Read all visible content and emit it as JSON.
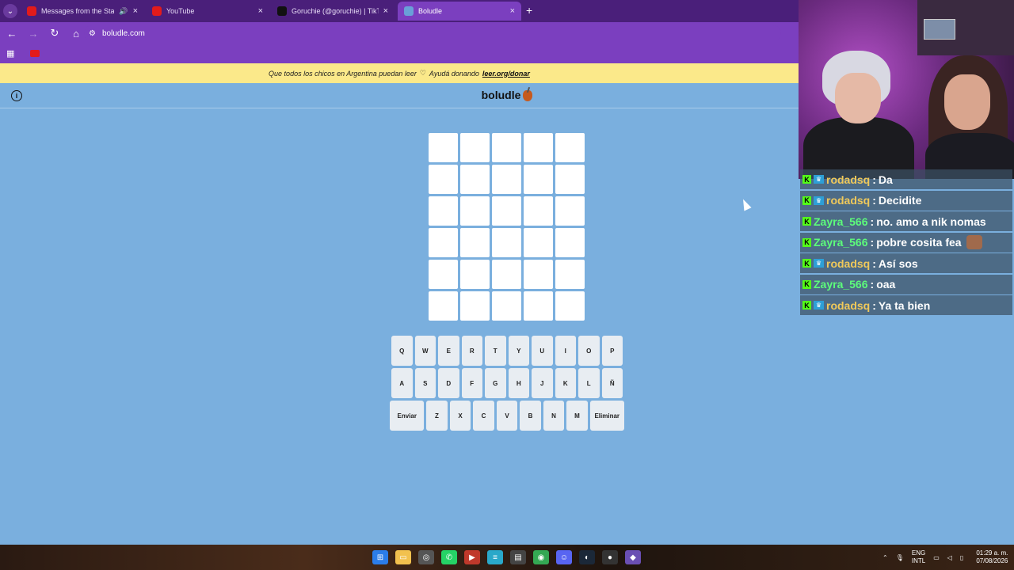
{
  "browser": {
    "tabs": [
      {
        "title": "Messages from the Stars - Y",
        "icon": "youtube-icon",
        "color": "#e21b1b",
        "muted": true
      },
      {
        "title": "YouTube",
        "icon": "youtube-icon",
        "color": "#e21b1b",
        "muted": false
      },
      {
        "title": "Goruchie (@goruchie) | TikTok",
        "icon": "tiktok-icon",
        "color": "#111111",
        "muted": false
      },
      {
        "title": "Boludle",
        "icon": "globe-icon",
        "color": "#6aa0d8",
        "muted": false
      }
    ],
    "url": "boludle.com"
  },
  "banner": {
    "text": "Que todos los chicos en Argentina puedan leer",
    "cta": "Ayudá donando",
    "link": "leer.org/donar"
  },
  "header": {
    "title": "boludle"
  },
  "board": {
    "rows": 6,
    "cols": 5
  },
  "keyboard": {
    "row1": [
      "Q",
      "W",
      "E",
      "R",
      "T",
      "Y",
      "U",
      "I",
      "O",
      "P"
    ],
    "row2": [
      "A",
      "S",
      "D",
      "F",
      "G",
      "H",
      "J",
      "K",
      "L",
      "Ñ"
    ],
    "row3": [
      "Enviar",
      "Z",
      "X",
      "C",
      "V",
      "B",
      "N",
      "M",
      "Eliminar"
    ]
  },
  "chat": [
    {
      "user": "rodadsq",
      "text": "Da",
      "green": false,
      "prime": true
    },
    {
      "user": "rodadsq",
      "text": "Decidite",
      "green": false,
      "prime": true
    },
    {
      "user": "Zayra_566",
      "text": "no. amo a nik nomas",
      "green": true,
      "prime": false
    },
    {
      "user": "Zayra_566",
      "text": "pobre cosita fea",
      "green": true,
      "prime": false,
      "emote": true
    },
    {
      "user": "rodadsq",
      "text": "Así sos",
      "green": false,
      "prime": true
    },
    {
      "user": "Zayra_566",
      "text": "oaa",
      "green": true,
      "prime": false
    },
    {
      "user": "rodadsq",
      "text": "Ya ta bien",
      "green": false,
      "prime": true
    }
  ],
  "taskbar": {
    "lang_top": "ENG",
    "lang_bottom": "INTL",
    "time": "01:29 a. m.",
    "date": "07/08/2026"
  }
}
